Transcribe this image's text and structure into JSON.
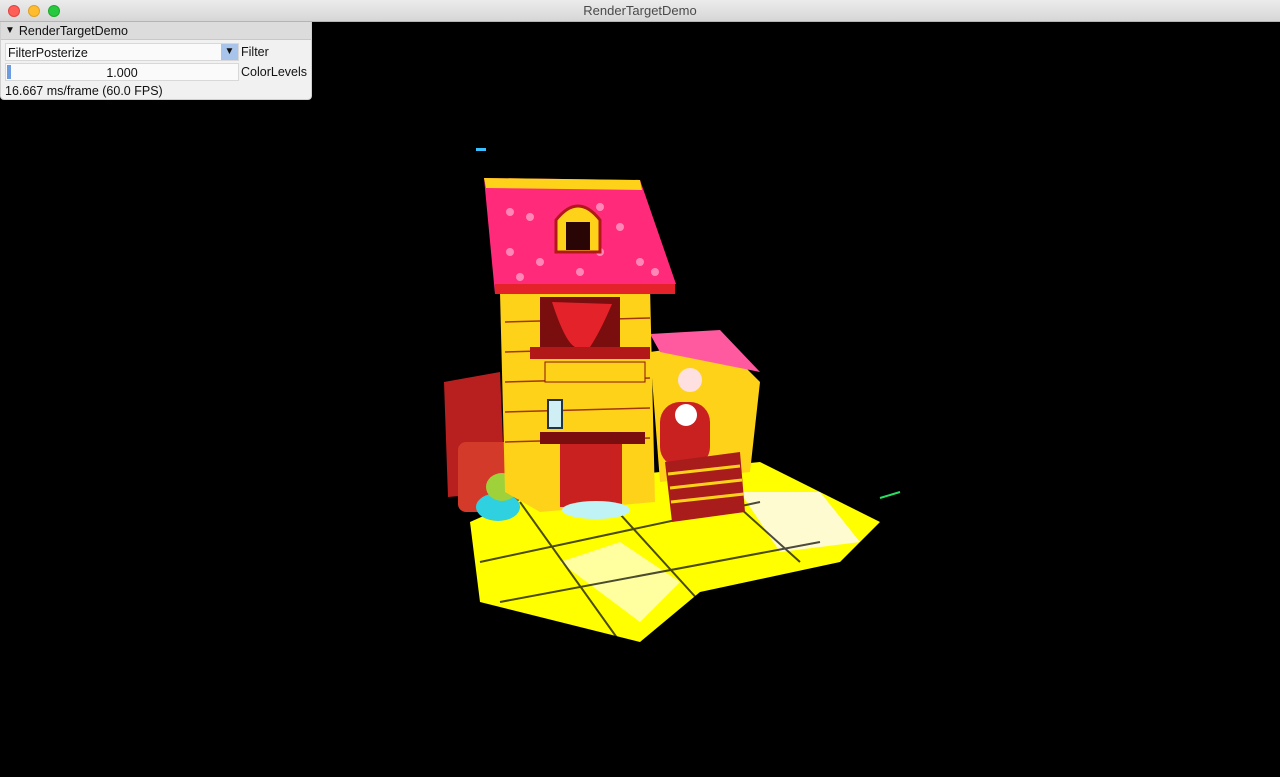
{
  "window": {
    "title": "RenderTargetDemo"
  },
  "panel": {
    "title": "RenderTargetDemo",
    "filter_combo": {
      "value": "FilterPosterize",
      "label": "Filter"
    },
    "color_levels": {
      "value": "1.000",
      "label": "ColorLevels"
    },
    "fps_text": "16.667 ms/frame (60.0 FPS)"
  },
  "scene": {
    "description_hidden": false,
    "colors": {
      "roof": "#ff2a7a",
      "wall": "#ffe600",
      "accent": "#d61f26",
      "ground": "#ffff00",
      "background": "#000000"
    }
  }
}
